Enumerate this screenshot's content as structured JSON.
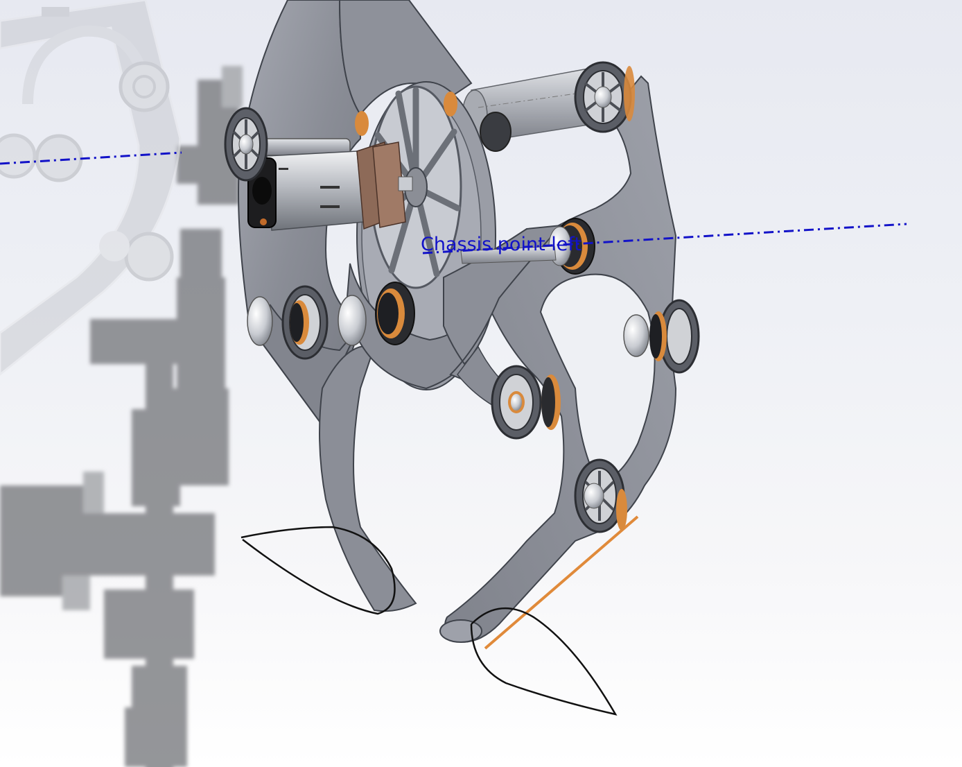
{
  "scene": {
    "annotation_label": "Chassis point left",
    "colors": {
      "background_top": "#e7e9f1",
      "background_bottom": "#ffffff",
      "plate": "#8c8f99",
      "plate_edge": "#3f434b",
      "bearing_copper": "#d98a3c",
      "annotation_blue": "#1212c8",
      "trajectory": "#111111"
    },
    "icons": [
      "motor-icon",
      "flywheel-icon",
      "bearing-icon",
      "ground-shadow"
    ]
  }
}
